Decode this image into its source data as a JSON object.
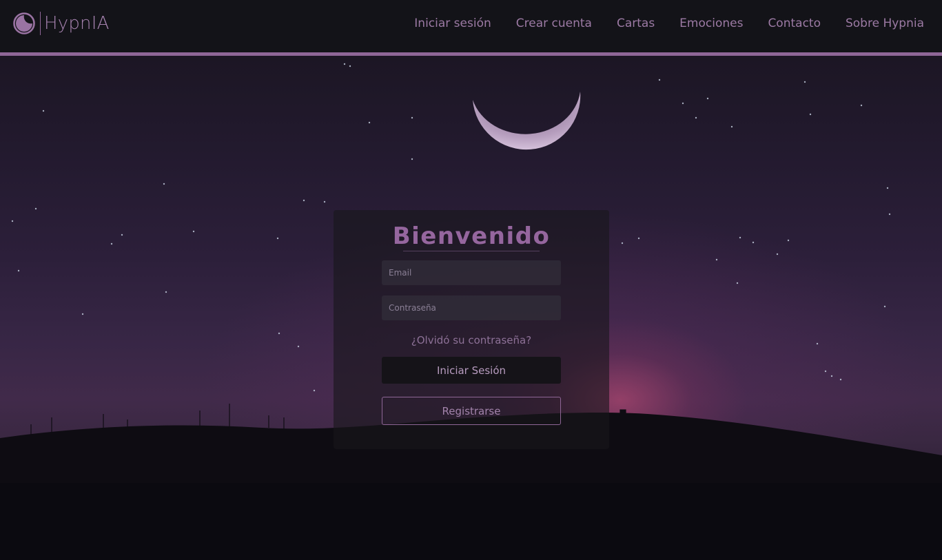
{
  "brand": {
    "name": "HypnIA",
    "logo_icon": "moon-face-icon"
  },
  "nav": {
    "links": [
      {
        "label": "Iniciar sesión"
      },
      {
        "label": "Crear cuenta"
      },
      {
        "label": "Cartas"
      },
      {
        "label": "Emociones"
      },
      {
        "label": "Contacto"
      },
      {
        "label": "Sobre Hypnia"
      }
    ]
  },
  "login": {
    "title": "Bienvenido",
    "email_placeholder": "Email",
    "password_placeholder": "Contraseña",
    "forgot_label": "¿Olvidó su contraseña?",
    "login_button": "Iniciar Sesión",
    "register_button": "Registrarse"
  },
  "colors": {
    "accent": "#8f6697",
    "navbar_bg": "#131318",
    "title": "#95669e"
  }
}
